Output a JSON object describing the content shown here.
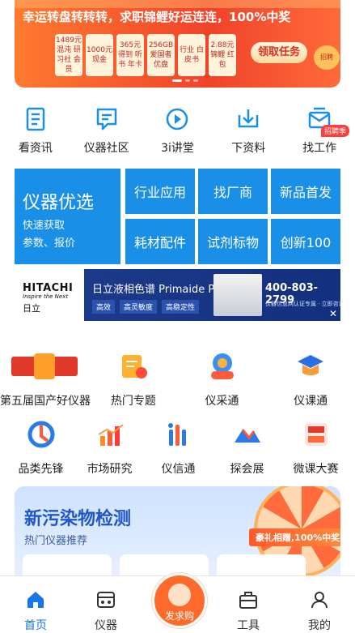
{
  "banner": {
    "slogan": "幸运转盘转转转，求职锦鲤好运连连，100%中奖",
    "prizes": [
      "1489元 混沌 研习社 会员",
      "1000元 现金",
      "365元 得到 听书 年卡",
      "256GB 爱国者 优盘",
      "行业 白皮书",
      "2.88元 锦鲤 红包"
    ],
    "task_button": "领取任务",
    "coin_label": "招聘"
  },
  "quick_nav": [
    {
      "label": "看资讯",
      "icon": "news-doc-icon"
    },
    {
      "label": "仪器社区",
      "icon": "community-chat-icon"
    },
    {
      "label": "3i讲堂",
      "icon": "play-video-icon"
    },
    {
      "label": "下资料",
      "icon": "download-icon"
    },
    {
      "label": "找工作",
      "icon": "job-mail-icon",
      "badge": "招聘季"
    }
  ],
  "grid": {
    "big_title": "仪器优选",
    "big_sub1": "快速获取",
    "big_sub2": "参数、报价",
    "tiles": [
      "行业应用",
      "找厂商",
      "新品首发",
      "耗材配件",
      "试剂标物",
      "创新100"
    ]
  },
  "ad": {
    "brand": "HITACHI",
    "tagline": "Inspire the Next",
    "brand_cn": "日立",
    "title": "日立液相色谱 Primaide PLUS",
    "tags": [
      "高效",
      "高灵敏度",
      "高稳定性"
    ],
    "phone": "400-803-2799",
    "note": "仪器信息网认证专属 · 立即咨询",
    "close": "✕"
  },
  "row1": [
    {
      "label": "第五届国产好仪器",
      "icon": "domestic-instrument-logo-icon"
    },
    {
      "label": "热门专题",
      "icon": "hot-topic-icon"
    },
    {
      "label": "仪采通",
      "icon": "procurement-icon"
    },
    {
      "label": "仪课通",
      "icon": "graduation-cap-icon"
    }
  ],
  "row2": [
    {
      "label": "品类先锋",
      "icon": "pioneer-icon"
    },
    {
      "label": "市场研究",
      "icon": "bar-chart-icon"
    },
    {
      "label": "仪信通",
      "icon": "signal-bars-icon"
    },
    {
      "label": "探会展",
      "icon": "exhibition-icon"
    },
    {
      "label": "微课大赛",
      "icon": "micro-course-contest-icon"
    }
  ],
  "promo": {
    "title": "新污染物检测",
    "subtitle": "热门仪器推荐",
    "cta": "豪礼相赠,100%中奖"
  },
  "tabbar": {
    "home": "首页",
    "instrument": "仪器",
    "buy": "发求购",
    "tools": "工具",
    "mine": "我的"
  },
  "colors": {
    "primary": "#1a8fe8",
    "accent": "#1877e6",
    "banner": "#f0432a"
  }
}
